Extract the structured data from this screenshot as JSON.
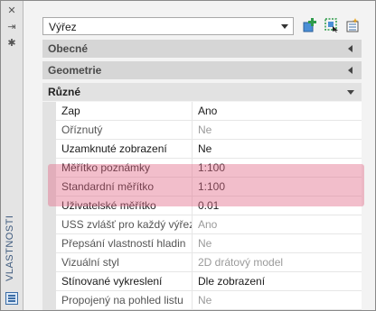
{
  "sidebar": {
    "title": "VLASTNOSTI",
    "close_glyph": "✕",
    "autohide_glyph": "⇥",
    "settings_glyph": "✱"
  },
  "toolbar": {
    "combo_value": "Výřez"
  },
  "sections": {
    "general": "Obecné",
    "geometry": "Geometrie",
    "misc": "Různé"
  },
  "rows": [
    {
      "label": "Zap",
      "value": "Ano"
    },
    {
      "label": "Oříznutý",
      "value": "Ne"
    },
    {
      "label": "Uzamknuté zobrazení",
      "value": "Ne"
    },
    {
      "label": "Měřítko poznámky",
      "value": "1:100"
    },
    {
      "label": "Standardní měřítko",
      "value": "1:100"
    },
    {
      "label": "Uživatelské měřítko",
      "value": "0.01"
    },
    {
      "label": "USS zvlášť pro každý výřez",
      "value": "Ano"
    },
    {
      "label": "Přepsání vlastností hladin",
      "value": "Ne"
    },
    {
      "label": "Vizuální styl",
      "value": "2D drátový model"
    },
    {
      "label": "Stínované vykreslení",
      "value": "Dle zobrazení"
    },
    {
      "label": "Propojený na pohled listu",
      "value": "Ne"
    }
  ],
  "colors": {
    "highlight": "#e26e8c",
    "section_bg": "#d6d6d6",
    "accent_blue": "#3b6da6",
    "accent_green": "#2e9b4a"
  }
}
